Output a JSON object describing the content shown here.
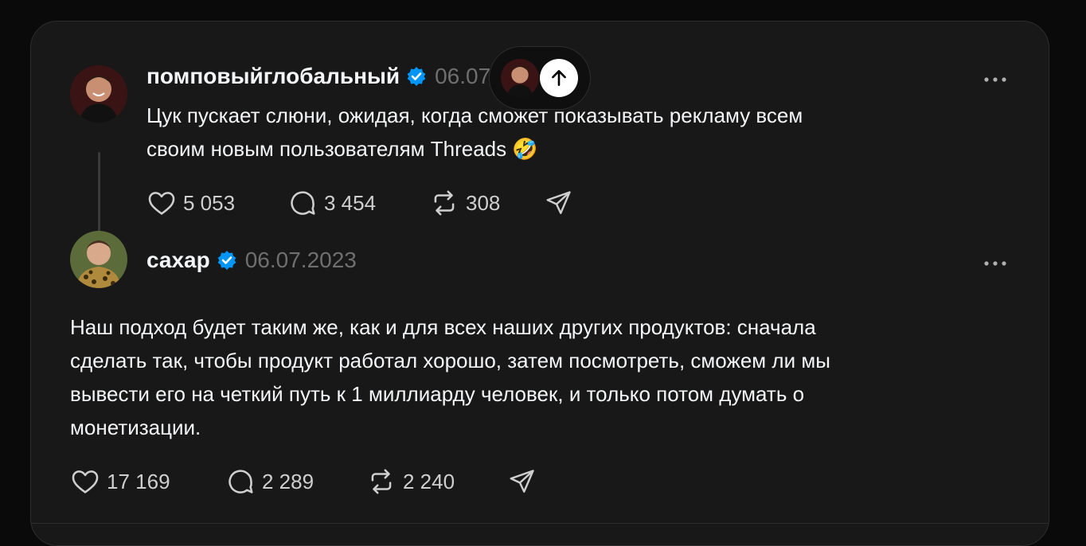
{
  "posts": [
    {
      "username": "помповыйглобальный",
      "date": "06.07.2023",
      "text_line1": "Цук пускает слюни, ожидая, когда сможет показывать рекламу всем",
      "text_line2": "своим новым пользователям Threads",
      "emoji": "🤣",
      "likes": "5 053",
      "replies": "3 454",
      "reposts": "308"
    },
    {
      "username": "сахар",
      "date": "06.07.2023",
      "text_lines": [
        "Наш подход будет таким же, как и для всех наших других продуктов: сначала",
        "сделать так, чтобы продукт работал хорошо, затем посмотреть, сможем ли мы",
        "вывести его на четкий путь к 1 миллиарду человек, и только потом думать о",
        "монетизации."
      ],
      "likes": "17 169",
      "replies": "2 289",
      "reposts": "2 240"
    }
  ],
  "icons": {
    "verified": "verified-badge-icon",
    "like": "heart-icon",
    "reply": "comment-icon",
    "repost": "repost-icon",
    "share": "send-icon",
    "more": "more-icon",
    "scroll_top": "arrow-up-icon"
  },
  "colors": {
    "background": "#0a0a0a",
    "card": "#181818",
    "verified": "#0095f6",
    "muted": "#6f6f6f"
  }
}
